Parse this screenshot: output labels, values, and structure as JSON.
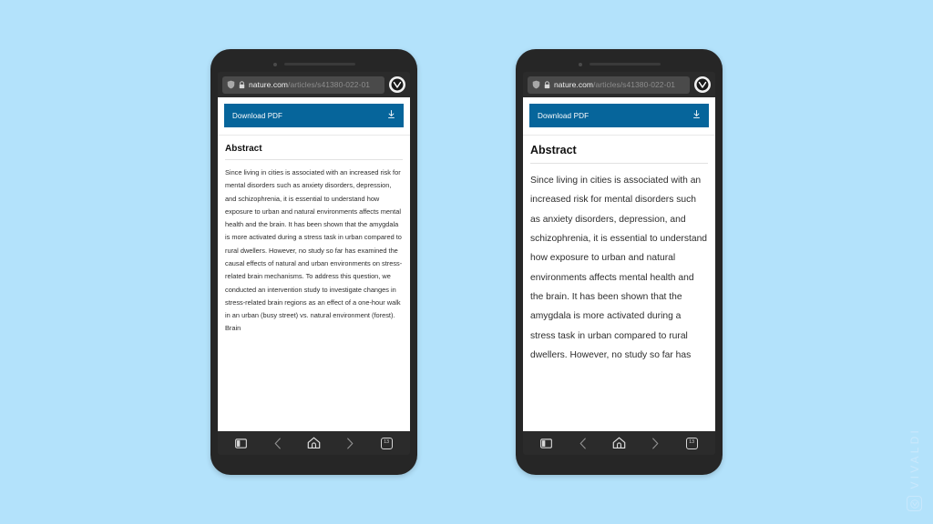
{
  "background_color": "#b3e2fb",
  "phones": [
    {
      "id": "left",
      "variant": "default-zoom",
      "browser": {
        "shield_icon": "shield-icon",
        "lock_icon": "lock-icon",
        "url_host": "nature.com",
        "url_path": "/articles/s41380-022-01",
        "vivaldi_icon": "vivaldi-logo-icon"
      },
      "page": {
        "pdf_button_label": "Download PDF",
        "pdf_button_icon": "download-icon",
        "pdf_button_color": "#06659b",
        "abstract_heading": "Abstract",
        "abstract_body": "Since living in cities is associated with an increased risk for mental disorders such as anxiety disorders, depression, and schizophrenia, it is essential to understand how exposure to urban and natural environments affects mental health and the brain. It has been shown that the amygdala is more activated during a stress task in urban compared to rural dwellers. However, no study so far has examined the causal effects of natural and urban environments on stress-related brain mechanisms. To address this question, we conducted an intervention study to investigate changes in stress-related brain regions as an effect of a one-hour walk in an urban (busy street) vs. natural environment (forest). Brain"
      },
      "nav": {
        "panel_label": "Panels",
        "back_label": "Back",
        "home_label": "Home",
        "forward_label": "Forward",
        "tab_count": "13"
      }
    },
    {
      "id": "right",
      "variant": "increased-zoom",
      "browser": {
        "shield_icon": "shield-icon",
        "lock_icon": "lock-icon",
        "url_host": "nature.com",
        "url_path": "/articles/s41380-022-01",
        "vivaldi_icon": "vivaldi-logo-icon"
      },
      "page": {
        "pdf_button_label": "Download PDF",
        "pdf_button_icon": "download-icon",
        "pdf_button_color": "#06659b",
        "abstract_heading": "Abstract",
        "abstract_body": "Since living in cities is associated with an increased risk for mental disorders such as anxiety disorders, depression, and schizophrenia, it is essential to understand how exposure to urban and natural environments affects mental health and the brain. It has been shown that the amygdala is more activated during a stress task in urban compared to rural dwellers. However, no study so far has"
      },
      "nav": {
        "panel_label": "Panels",
        "back_label": "Back",
        "home_label": "Home",
        "forward_label": "Forward",
        "tab_count": "13"
      }
    }
  ],
  "watermark": {
    "text": "VIVALDI",
    "logo_icon": "vivaldi-logo-icon"
  }
}
